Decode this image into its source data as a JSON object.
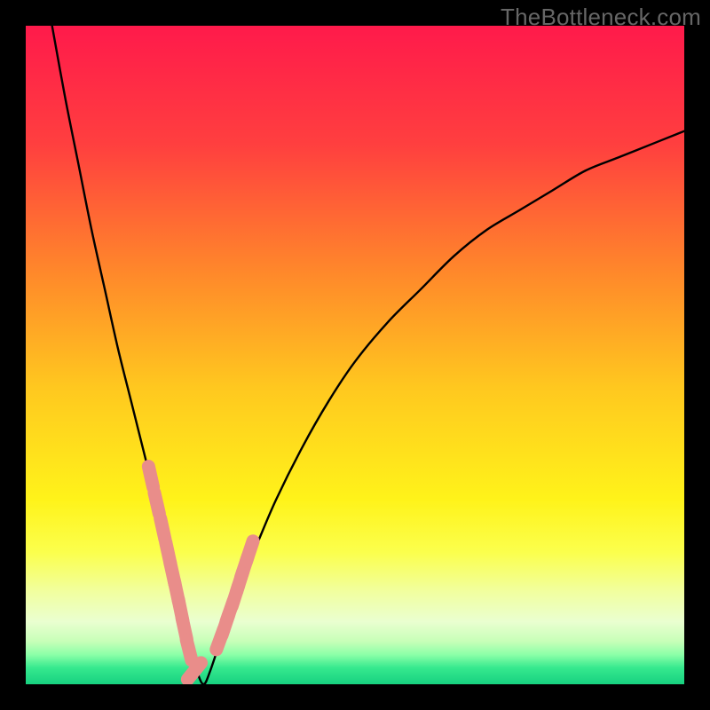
{
  "watermark": "TheBottleneck.com",
  "chart_data": {
    "type": "line",
    "title": "",
    "xlabel": "",
    "ylabel": "",
    "xlim": [
      0,
      100
    ],
    "ylim": [
      0,
      100
    ],
    "series": [
      {
        "name": "bottleneck-curve",
        "x": [
          4,
          6,
          8,
          10,
          12,
          14,
          16,
          18,
          20,
          21,
          22,
          23,
          24,
          25,
          26,
          27,
          28,
          30,
          32,
          35,
          38,
          42,
          46,
          50,
          55,
          60,
          65,
          70,
          75,
          80,
          85,
          90,
          95,
          100
        ],
        "y": [
          100,
          89,
          79,
          69,
          60,
          51,
          43,
          35,
          27,
          23,
          19,
          15,
          10,
          6,
          2,
          0,
          2,
          8,
          14,
          21,
          28,
          36,
          43,
          49,
          55,
          60,
          65,
          69,
          72,
          75,
          78,
          80,
          82,
          84
        ]
      }
    ],
    "markers": {
      "name": "highlight-points",
      "x": [
        19.0,
        19.9,
        20.8,
        21.6,
        22.3,
        22.9,
        23.5,
        24.1,
        24.8,
        25.6,
        29.5,
        30.3,
        31.0,
        31.8,
        32.5,
        33.2,
        34.0
      ],
      "y": [
        31.5,
        27.5,
        23.6,
        20.0,
        16.8,
        14.1,
        11.3,
        8.4,
        5.2,
        2.0,
        6.8,
        9.0,
        11.1,
        13.4,
        15.6,
        17.8,
        20.2
      ]
    },
    "gradient_stops": [
      {
        "pos": 0.0,
        "color": "#ff1a4b"
      },
      {
        "pos": 0.18,
        "color": "#ff3f3f"
      },
      {
        "pos": 0.38,
        "color": "#ff8a2a"
      },
      {
        "pos": 0.55,
        "color": "#ffc81f"
      },
      {
        "pos": 0.72,
        "color": "#fff31a"
      },
      {
        "pos": 0.8,
        "color": "#fbff4d"
      },
      {
        "pos": 0.86,
        "color": "#f1ffa0"
      },
      {
        "pos": 0.905,
        "color": "#eaffd0"
      },
      {
        "pos": 0.935,
        "color": "#c7ffb8"
      },
      {
        "pos": 0.955,
        "color": "#8cffa8"
      },
      {
        "pos": 0.975,
        "color": "#36e98e"
      },
      {
        "pos": 1.0,
        "color": "#17d180"
      }
    ]
  }
}
